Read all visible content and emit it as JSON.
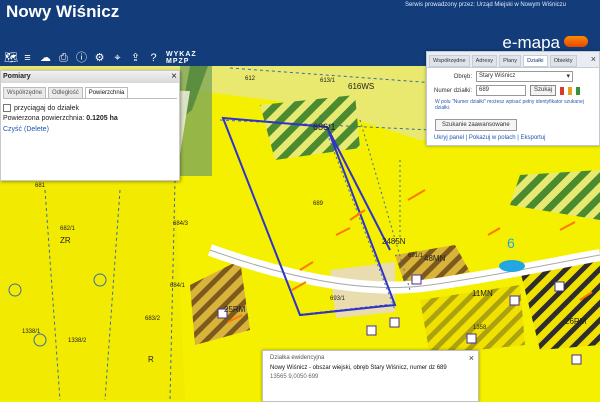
{
  "app_title": "Nowy Wiśnicz",
  "service_text": "Serwis prowadzony przez: Urząd Miejski w Nowym Wiśniczu",
  "brand": "e-mapa",
  "toolbar": {
    "icons": [
      "map-icon",
      "layers-icon",
      "cloud-icon",
      "print-icon",
      "info-icon",
      "settings-icon",
      "pin-icon",
      "share-icon",
      "help-icon"
    ],
    "wykaz_top": "WYKAZ",
    "wykaz_bottom": "MPZP"
  },
  "measure_panel": {
    "title": "Pomiary",
    "tabs": [
      "Współrzędne",
      "Odległość",
      "Powierzchnia"
    ],
    "active_tab": "Powierzchnia",
    "snap_label": "przyciągaj do działek",
    "area_label": "Powierzona powierzchnia:",
    "area_value": "0.1205 ha",
    "clear_label": "Czyść (Delete)"
  },
  "search_panel": {
    "tabs": [
      "Współrzędne",
      "Adresy",
      "Plany",
      "Działki",
      "Obiekty"
    ],
    "active_tab": "Działki",
    "obreb_label": "Obręb:",
    "obreb_value": "Stary Wiśnicz",
    "numer_label": "Numer działki:",
    "numer_value": "689",
    "search_button": "Szukaj",
    "hint": "W polu \"Numer działki\" możesz wpisać pełny identyfikator szukanej działki.",
    "advanced_button": "Szukanie zaawansowane",
    "links": "Ukryj panel  |  Pokazuj w polach  |  Eksportuj",
    "swatches": [
      "#d83b2d",
      "#e2a31c",
      "#3a8f3a"
    ]
  },
  "popup": {
    "title": "Działka ewidencyjna",
    "main": "Nowy Wiśnicz - obszar wiejski, obręb Stary Wiśnicz, numer dz 689",
    "sub": "13565 9,0050 699"
  },
  "map_labels": {
    "parcels": [
      "612",
      "613/1",
      "616WS",
      "686/1",
      "689",
      "691/1",
      "2485N",
      "48MN",
      "11MN",
      "25RM",
      "26RM",
      "684/3",
      "684/1",
      "683/2",
      "681",
      "682/1",
      "ZR",
      "R",
      "1338/1",
      "1338/2",
      "1358",
      "693/1"
    ],
    "marker": "6"
  }
}
